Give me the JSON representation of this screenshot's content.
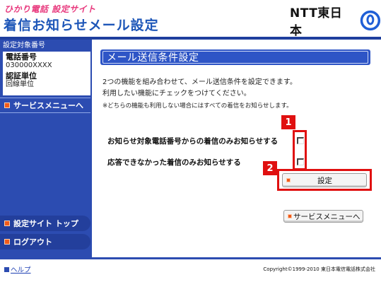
{
  "header": {
    "subtitle": "ひかり電話 設定サイト",
    "title": "着信お知らせメール設定",
    "brand": "NTT東日本"
  },
  "sidebar": {
    "target_label": "設定対象番号",
    "phone_key": "電話番号",
    "phone_value": "030000XXXX",
    "unit_key": "認証単位",
    "unit_value": "回線単位",
    "service_menu_label": "サービスメニューへ",
    "nav": [
      {
        "label": "設定サイト トップ"
      },
      {
        "label": "ログアウト"
      }
    ]
  },
  "main": {
    "title": "メール送信条件設定",
    "description": [
      "2つの機能を組み合わせて、メール送信条件を設定できます。",
      "利用したい機能にチェックをつけてください。"
    ],
    "note": "※どちらの機能も利用しない場合にはすべての着信をお知らせします。",
    "options": [
      {
        "label": "お知らせ対象電話番号からの着信のみお知らせする",
        "checked": false
      },
      {
        "label": "応答できなかった着信のみお知らせする",
        "checked": false
      }
    ],
    "submit_label": "設定",
    "service_menu_button": "サービスメニューへ",
    "callouts": [
      "1",
      "2"
    ]
  },
  "footer": {
    "help": "ヘルプ",
    "copyright": "Copyright©1999-2010 東日本電信電話株式会社"
  },
  "colors": {
    "primary_blue": "#2c4cb1",
    "title_blue": "#1d56b8",
    "accent_pink": "#e83a7e",
    "callout_red": "#e01010",
    "bullet_orange": "#f05a1a"
  }
}
